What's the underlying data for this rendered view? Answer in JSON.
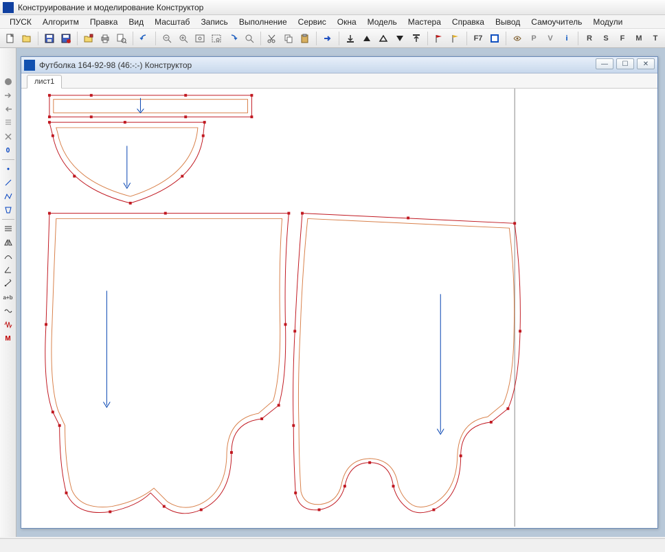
{
  "app": {
    "title": "Конструирование и моделирование  Конструктор"
  },
  "menu": {
    "items": [
      "ПУСК",
      "Алгоритм",
      "Правка",
      "Вид",
      "Масштаб",
      "Запись",
      "Выполнение",
      "Сервис",
      "Окна",
      "Модель",
      "Мастера",
      "Справка",
      "Вывод",
      "Самоучитель",
      "Модули"
    ]
  },
  "toolbar": {
    "f7_label": "F7",
    "letters": {
      "p": "P",
      "v": "V",
      "i": "i",
      "r": "R",
      "s": "S",
      "f": "F",
      "m": "M",
      "t": "T"
    }
  },
  "left_tools": {
    "zero": "0",
    "ab": "a+b",
    "m": "M"
  },
  "child": {
    "title": "Футболка 164-92-98 (46:-:-) Конструктор",
    "tab": "лист1"
  }
}
